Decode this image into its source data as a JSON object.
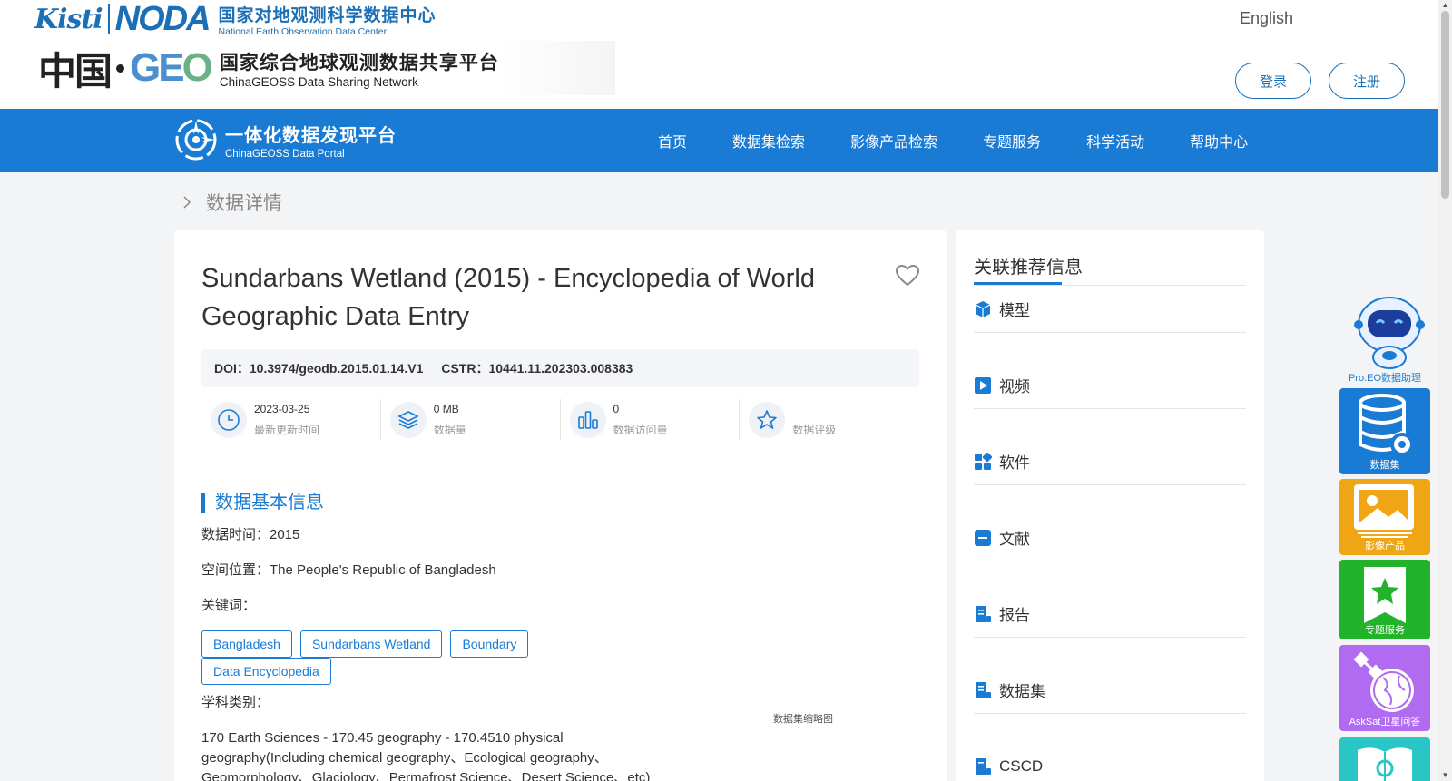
{
  "header": {
    "kisti_logo": "Kisti",
    "noda_logo": "NODA",
    "noda_cn": "国家对地观测科学数据中心",
    "noda_en": "National Earth Observation Data Center",
    "china_geo_cn": "中国",
    "geo_logo_g": "GE",
    "geo_logo_o": "O",
    "geoss_cn": "国家综合地球观测数据共享平台",
    "geoss_en": "ChinaGEOSS Data Sharing Network",
    "language": "English",
    "login_label": "登录",
    "register_label": "注册"
  },
  "nav": {
    "portal_cn": "一体化数据发现平台",
    "portal_en": "ChinaGEOSS Data Portal",
    "items": [
      {
        "label": "首页"
      },
      {
        "label": "数据集检索"
      },
      {
        "label": "影像产品检索"
      },
      {
        "label": "专题服务"
      },
      {
        "label": "科学活动"
      },
      {
        "label": "帮助中心"
      }
    ]
  },
  "breadcrumb": {
    "current": "数据详情"
  },
  "detail": {
    "title": "Sundarbans Wetland (2015) - Encyclopedia of World Geographic Data Entry",
    "doi_label": "DOI：",
    "doi_value": "10.3974/geodb.2015.01.14.V1",
    "cstr_label": "CSTR：",
    "cstr_value": "10441.11.202303.008383",
    "stats": [
      {
        "value": "2023-03-25",
        "label": "最新更新时间",
        "icon": "clock-icon"
      },
      {
        "value": "0 MB",
        "label": "数据量",
        "icon": "layers-icon"
      },
      {
        "value": "0",
        "label": "数据访问量",
        "icon": "bar-chart-icon"
      },
      {
        "value": "",
        "label": "数据评级",
        "icon": "star-icon"
      }
    ],
    "section_title": "数据基本信息",
    "data_time": "数据时间：2015",
    "spatial_location": "空间位置：The People's Republic of Bangladesh",
    "keywords_label": "关键词：",
    "keywords": [
      "Bangladesh",
      "Sundarbans Wetland",
      "Boundary",
      "Data Encyclopedia"
    ],
    "subject_label": "学科类别：",
    "subject_text": "170 Earth Sciences - 170.45 geography - 170.4510 physical geography(Including chemical geography、Ecological geography、Geomorphology、Glaciology、Permafrost Science、Desert Science、etc)",
    "thumbnail_label": "数据集缩略图"
  },
  "related": {
    "title": "关联推荐信息",
    "items": [
      {
        "label": "模型",
        "icon": "cube-icon"
      },
      {
        "label": "视频",
        "icon": "video-icon"
      },
      {
        "label": "软件",
        "icon": "apps-icon"
      },
      {
        "label": "文献",
        "icon": "document-icon"
      },
      {
        "label": "报告",
        "icon": "report-icon"
      },
      {
        "label": "数据集",
        "icon": "dataset-icon"
      },
      {
        "label": "CSCD",
        "icon": "cscd-icon"
      }
    ]
  },
  "float_toolbar": {
    "assistant": "Pro.EO数据助理",
    "dataset": "数据集",
    "image_product": "影像产品",
    "thematic": "专题服务",
    "asksat": "AskSat卫星问答"
  },
  "colors": {
    "primary": "#1a7bd5",
    "brand_dark": "#1b6fb6",
    "dataset_tile": "#1a7bd5",
    "image_tile": "#f0a515",
    "thematic_tile": "#22b32a",
    "asksat_tile": "#b06bf0",
    "book_tile": "#2ac5c5"
  }
}
